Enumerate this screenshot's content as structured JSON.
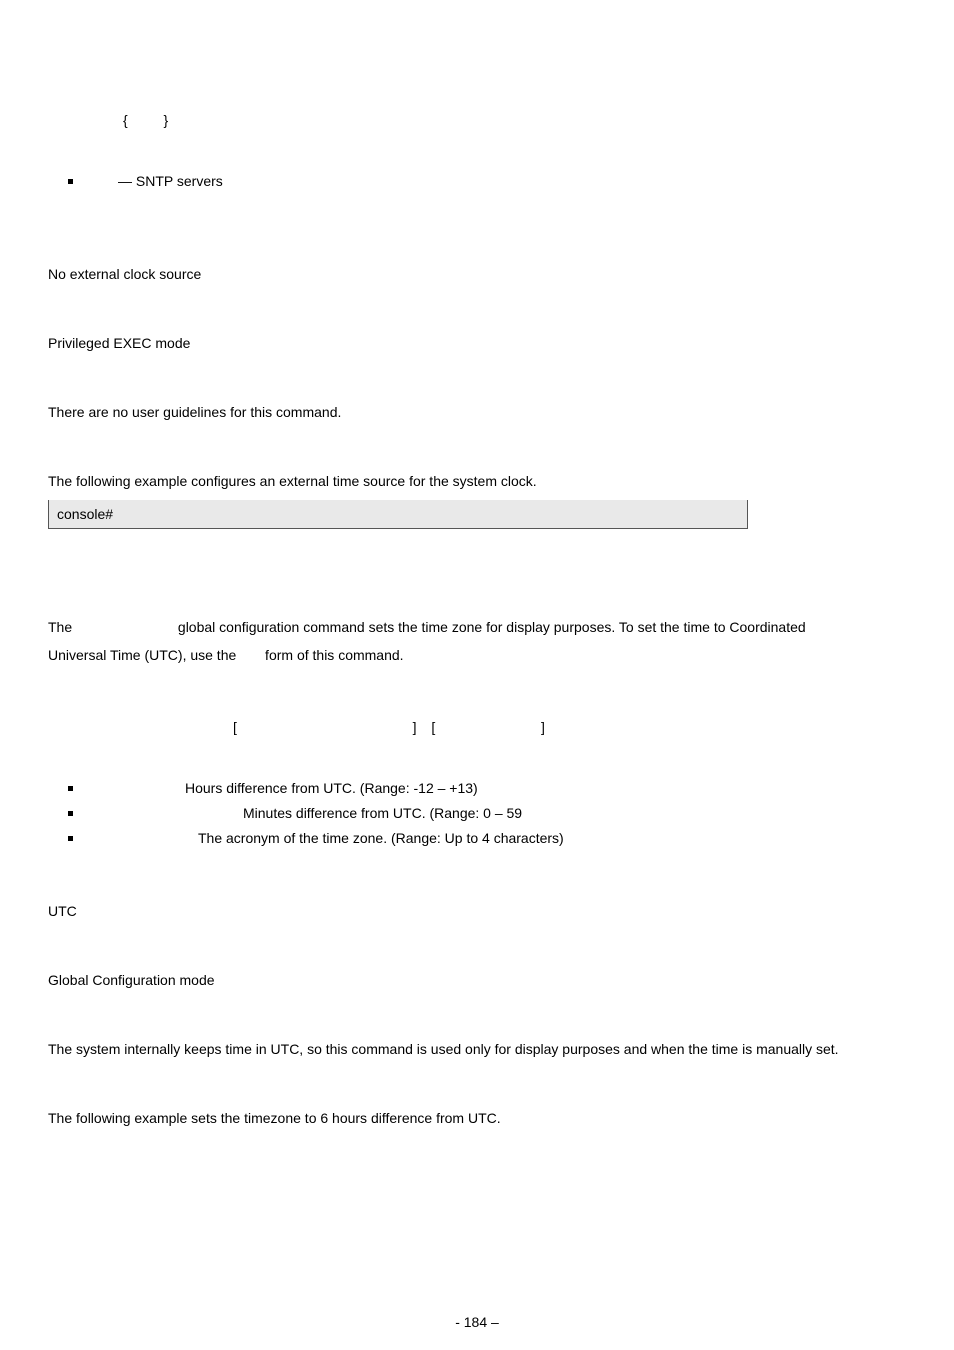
{
  "syntax1": {
    "open": "{",
    "close": "}"
  },
  "bullets1": [
    {
      "text": "— SNTP servers"
    }
  ],
  "section1": {
    "default": "No external clock source",
    "mode": "Privileged EXEC mode",
    "guidelines": "There are no user guidelines for this command.",
    "exampleIntro": "The following example configures an external time source for the system clock.",
    "code": "console#"
  },
  "desc2": {
    "p1a": "The ",
    "p1b": " global configuration command sets the time zone for display purposes. To set the time to Coordinated",
    "p2a": "Universal Time (UTC), use the ",
    "p2b": " form of this command."
  },
  "syntax2": {
    "lb1": "[",
    "rb1": "]",
    "lb2": "[",
    "rb2": "]"
  },
  "bullets2": [
    {
      "text": "Hours difference from UTC. (Range: -12 – +13)"
    },
    {
      "text": "Minutes difference from UTC. (Range: 0 – 59"
    },
    {
      "text": "The acronym of the time zone. (Range: Up to 4 characters)"
    }
  ],
  "section2": {
    "default": "UTC",
    "mode": "Global Configuration mode",
    "guidelines": "The system internally keeps time in UTC, so this command is used only for display purposes and when the time is manually set.",
    "exampleIntro": "The following example sets the timezone to 6 hours difference from UTC."
  },
  "footer": "- 184 –"
}
